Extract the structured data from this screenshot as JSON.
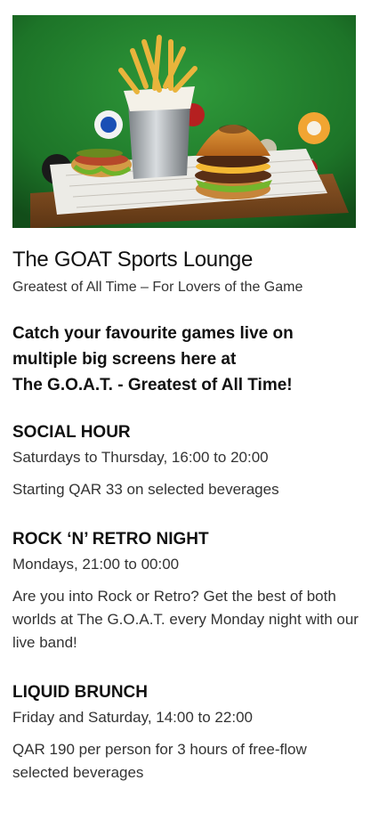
{
  "hero": {
    "image_alt": "Burger, fries and hot dog on a tray on a green pool table with billiard balls",
    "icon": "burger-fries-photo"
  },
  "header": {
    "title": "The GOAT Sports Lounge",
    "subtitle": "Greatest of All Time – For Lovers of the Game"
  },
  "intro": {
    "line1": "Catch your favourite games live on",
    "line2": "multiple big screens here at",
    "line3": "The G.O.A.T. - Greatest of All Time!"
  },
  "sections": [
    {
      "title": "SOCIAL HOUR",
      "time": "Saturdays to Thursday, 16:00 to 20:00",
      "description": "Starting QAR 33 on selected beverages"
    },
    {
      "title": "ROCK ‘N’ RETRO NIGHT",
      "time": "Mondays, 21:00 to 00:00",
      "description": "Are you into Rock or Retro? Get the best of both worlds at The G.O.A.T. every Monday night with our live band!"
    },
    {
      "title": "LIQUID BRUNCH",
      "time": "Friday and Saturday, 14:00 to 22:00",
      "description": "QAR 190 per person for 3 hours of free-flow selected beverages"
    }
  ],
  "colors": {
    "felt_green": "#1f7a2b",
    "text_dark": "#111111",
    "text_body": "#333333"
  }
}
